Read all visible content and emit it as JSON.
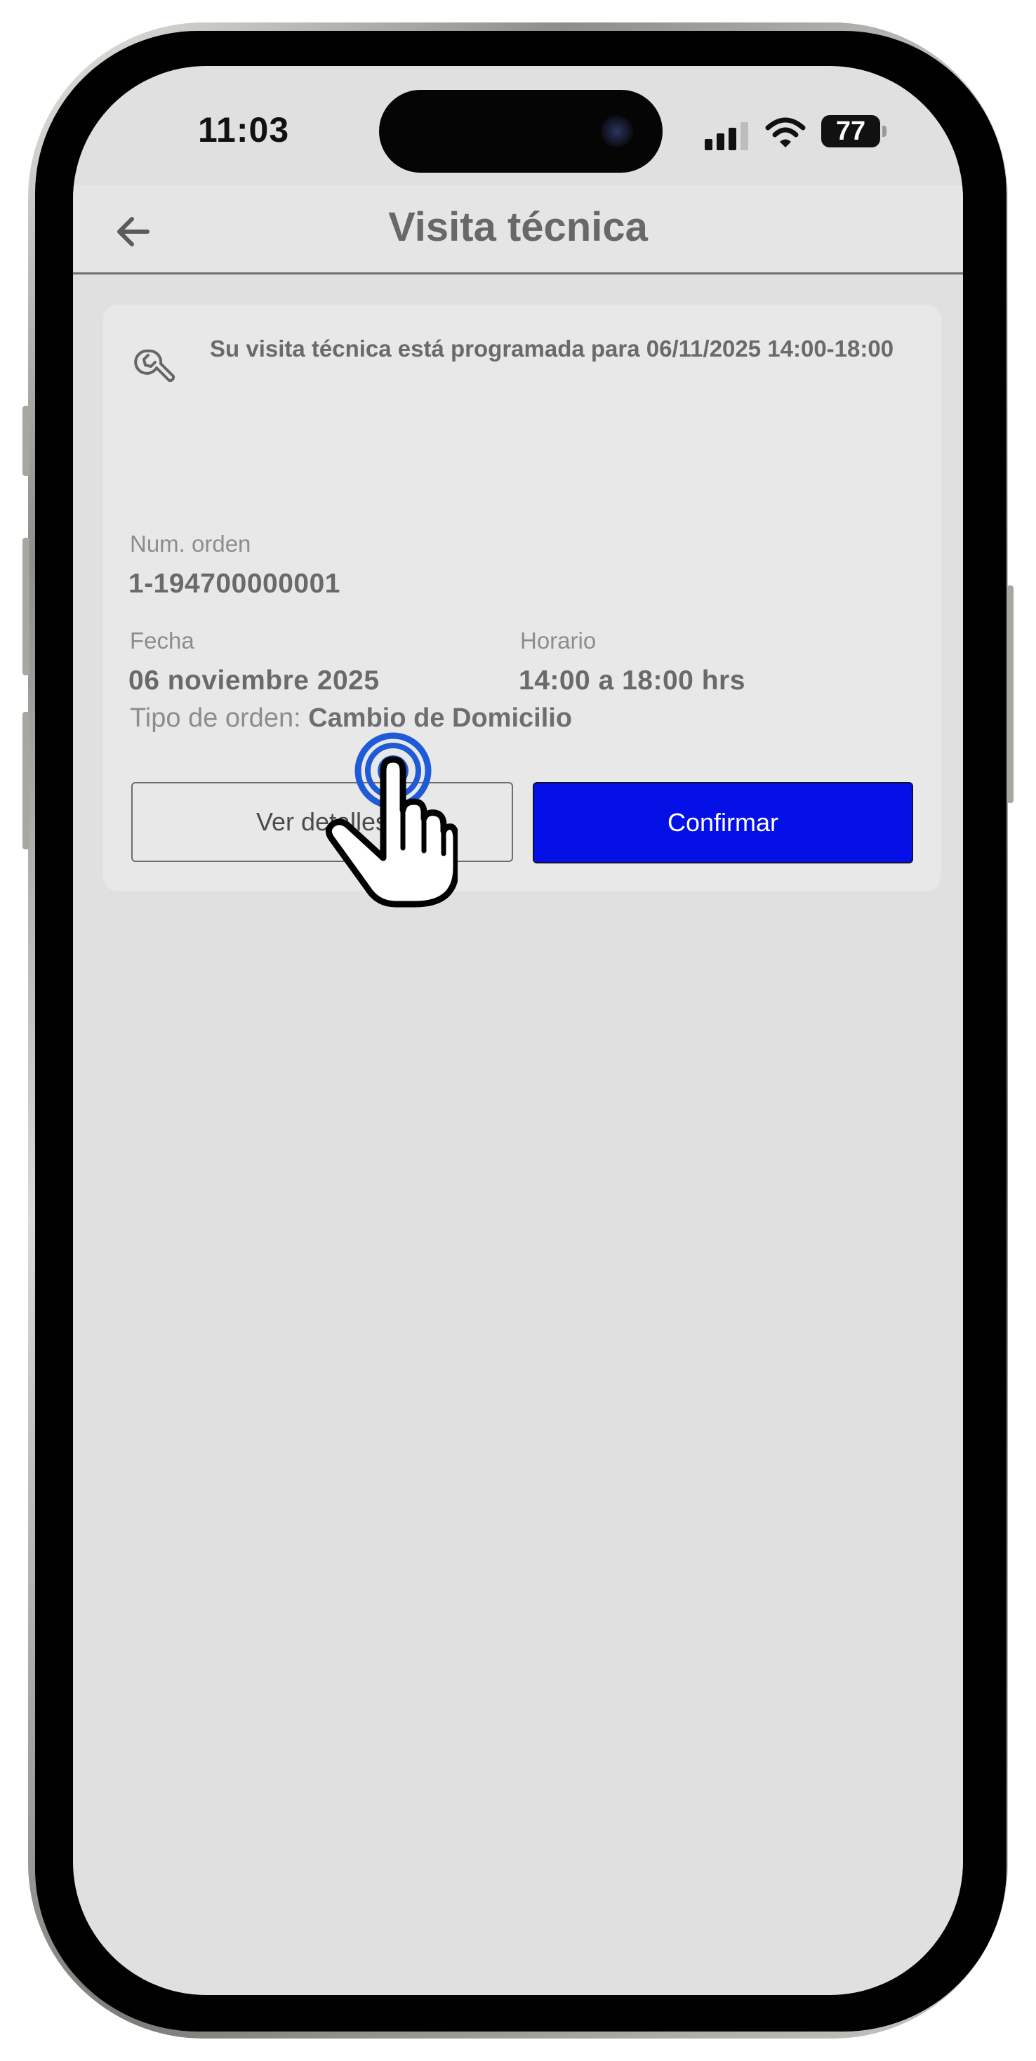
{
  "status_bar": {
    "time": "11:03",
    "battery": "77",
    "icons": [
      "signal-icon",
      "wifi-icon",
      "battery-icon"
    ]
  },
  "header": {
    "back_icon": "arrow-left-icon",
    "title": "Visita técnica"
  },
  "card": {
    "icon": "wrench-icon",
    "notice": "Su visita técnica está programada para 06/11/2025 14:00-18:00",
    "order_number_label": "Num. orden",
    "order_number_value": "1-194700000001",
    "date_label": "Fecha",
    "date_value": "06 noviembre 2025",
    "schedule_label": "Horario",
    "schedule_value": "14:00 a 18:00 hrs",
    "order_type_label": "Tipo de orden:",
    "order_type_value": "Cambio de Domicilio",
    "details_button": "Ver detalles",
    "confirm_button": "Confirmar"
  },
  "overlay": {
    "tap_indicator_icon": "tap-hand-icon"
  },
  "colors": {
    "primary_button": "#0410e6",
    "screen_background": "#e0e0e0",
    "card_background": "#e8e8e8",
    "tap_ring": "#1f5bd6"
  }
}
